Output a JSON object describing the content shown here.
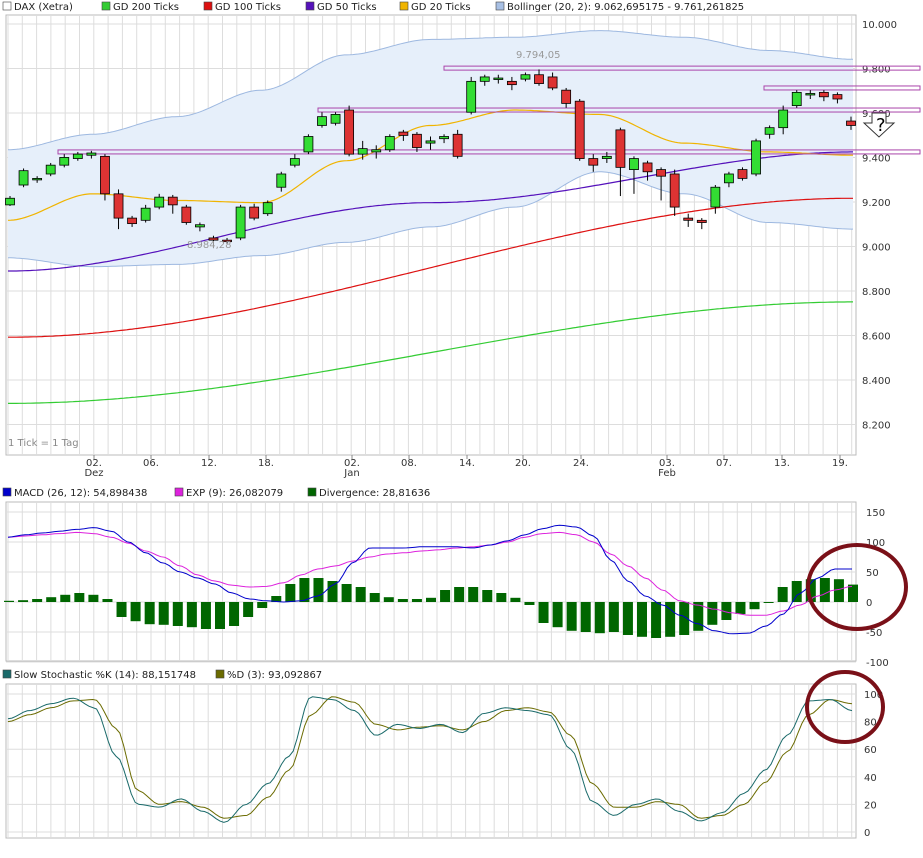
{
  "legends": {
    "price": [
      {
        "label": "DAX (Xetra)",
        "color": "#ffffff"
      },
      {
        "label": "GD 200 Ticks",
        "color": "#33cc33"
      },
      {
        "label": "GD 100 Ticks",
        "color": "#dd1111"
      },
      {
        "label": "GD 50 Ticks",
        "color": "#5511bb"
      },
      {
        "label": "GD 20 Ticks",
        "color": "#f0b400"
      },
      {
        "label": "Bollinger (20, 2): 9.062,695175 - 9.761,261825",
        "color": "#a8c0e4"
      }
    ],
    "macd": [
      {
        "label": "MACD (26, 12): 54,898438",
        "color": "#0000cc"
      },
      {
        "label": "EXP (9): 26,082079",
        "color": "#dd22dd"
      },
      {
        "label": "Divergence: 28,81636",
        "color": "#006600"
      }
    ],
    "stoch": [
      {
        "label": "Slow Stochastic %K (14): 88,151748",
        "color": "#1a6a6a"
      },
      {
        "label": "%D (3): 93,092867",
        "color": "#6b6b00"
      }
    ]
  },
  "annotations": {
    "tick_note": "1 Tick = 1 Tag",
    "high_label": "9.794,05",
    "low_label": "8.984,28",
    "question": "?"
  },
  "colors": {
    "up_candle": "#33dd33",
    "down_candle": "#dd3333",
    "grid": "#dddddd",
    "circle": "#7a1018",
    "resistance": "#aa44aa"
  },
  "chart_data": [
    {
      "type": "candlestick",
      "title": "DAX (Xetra)",
      "x_ticks": [
        {
          "label": "02.",
          "sub": "Dez"
        },
        {
          "label": "06.",
          "sub": ""
        },
        {
          "label": "12.",
          "sub": ""
        },
        {
          "label": "18.",
          "sub": ""
        },
        {
          "label": "02.",
          "sub": "Jan"
        },
        {
          "label": "08.",
          "sub": ""
        },
        {
          "label": "14.",
          "sub": ""
        },
        {
          "label": "20.",
          "sub": ""
        },
        {
          "label": "24.",
          "sub": ""
        },
        {
          "label": "03.",
          "sub": "Feb"
        },
        {
          "label": "07.",
          "sub": ""
        },
        {
          "label": "13.",
          "sub": ""
        },
        {
          "label": "19.",
          "sub": ""
        }
      ],
      "y_ticks": [
        "10.000",
        "9.800",
        "9.600",
        "9.400",
        "9.200",
        "9.000",
        "8.800",
        "8.600",
        "8.400",
        "8.200"
      ],
      "ylim": [
        8100,
        10050
      ],
      "candles": [
        [
          9180,
          9220,
          9175,
          9210
        ],
        [
          9270,
          9345,
          9260,
          9335
        ],
        [
          9300,
          9310,
          9280,
          9300
        ],
        [
          9320,
          9370,
          9310,
          9360
        ],
        [
          9360,
          9410,
          9350,
          9395
        ],
        [
          9390,
          9420,
          9380,
          9410
        ],
        [
          9405,
          9425,
          9390,
          9415
        ],
        [
          9400,
          9410,
          9200,
          9230
        ],
        [
          9230,
          9250,
          9070,
          9120
        ],
        [
          9120,
          9130,
          9080,
          9095
        ],
        [
          9110,
          9180,
          9100,
          9165
        ],
        [
          9170,
          9230,
          9160,
          9215
        ],
        [
          9215,
          9225,
          9140,
          9180
        ],
        [
          9170,
          9180,
          9090,
          9100
        ],
        [
          9080,
          9100,
          9060,
          9090
        ],
        [
          9030,
          9040,
          8984,
          9020
        ],
        [
          9020,
          9030,
          9005,
          9015
        ],
        [
          9030,
          9180,
          9020,
          9170
        ],
        [
          9170,
          9185,
          9110,
          9120
        ],
        [
          9140,
          9200,
          9130,
          9190
        ],
        [
          9260,
          9330,
          9240,
          9320
        ],
        [
          9360,
          9410,
          9350,
          9390
        ],
        [
          9420,
          9500,
          9410,
          9490
        ],
        [
          9540,
          9600,
          9530,
          9580
        ],
        [
          9550,
          9600,
          9540,
          9590
        ],
        [
          9610,
          9630,
          9400,
          9410
        ],
        [
          9410,
          9470,
          9385,
          9435
        ],
        [
          9420,
          9450,
          9390,
          9430
        ],
        [
          9430,
          9500,
          9420,
          9490
        ],
        [
          9510,
          9520,
          9470,
          9495
        ],
        [
          9500,
          9510,
          9420,
          9440
        ],
        [
          9460,
          9490,
          9430,
          9470
        ],
        [
          9480,
          9500,
          9460,
          9490
        ],
        [
          9500,
          9520,
          9390,
          9400
        ],
        [
          9600,
          9760,
          9590,
          9740
        ],
        [
          9740,
          9770,
          9720,
          9760
        ],
        [
          9750,
          9770,
          9730,
          9755
        ],
        [
          9740,
          9760,
          9700,
          9725
        ],
        [
          9750,
          9780,
          9740,
          9770
        ],
        [
          9770,
          9794,
          9720,
          9730
        ],
        [
          9760,
          9780,
          9700,
          9710
        ],
        [
          9700,
          9710,
          9620,
          9640
        ],
        [
          9650,
          9660,
          9380,
          9390
        ],
        [
          9390,
          9410,
          9330,
          9360
        ],
        [
          9390,
          9420,
          9370,
          9400
        ],
        [
          9520,
          9530,
          9220,
          9350
        ],
        [
          9340,
          9400,
          9230,
          9390
        ],
        [
          9370,
          9380,
          9290,
          9330
        ],
        [
          9340,
          9350,
          9200,
          9310
        ],
        [
          9320,
          9340,
          9130,
          9170
        ],
        [
          9120,
          9140,
          9080,
          9110
        ],
        [
          9110,
          9120,
          9070,
          9100
        ],
        [
          9170,
          9270,
          9140,
          9260
        ],
        [
          9280,
          9330,
          9260,
          9320
        ],
        [
          9340,
          9350,
          9290,
          9300
        ],
        [
          9320,
          9480,
          9310,
          9470
        ],
        [
          9500,
          9540,
          9480,
          9530
        ],
        [
          9530,
          9630,
          9500,
          9610
        ],
        [
          9630,
          9700,
          9620,
          9690
        ],
        [
          9680,
          9700,
          9660,
          9685
        ],
        [
          9690,
          9700,
          9650,
          9670
        ],
        [
          9680,
          9690,
          9640,
          9660
        ],
        [
          9560,
          9580,
          9520,
          9540
        ]
      ],
      "series": [
        {
          "name": "GD 200 Ticks",
          "values": [
            8280,
            8740
          ]
        },
        {
          "name": "GD 100 Ticks",
          "values": [
            8580,
            9210
          ]
        },
        {
          "name": "GD 50 Ticks",
          "values": [
            8880,
            9190,
            9420
          ]
        },
        {
          "name": "GD 20 Ticks",
          "values": [
            9110,
            9230,
            9200,
            9190,
            9380,
            9540,
            9610,
            9590,
            9460,
            9420,
            9405
          ]
        },
        {
          "name": "Bollinger upper",
          "values": [
            9430,
            9500,
            9580,
            9700,
            9860,
            9930,
            9940,
            9970,
            9940,
            9880,
            9840
          ]
        },
        {
          "name": "Bollinger lower",
          "values": [
            8940,
            8900,
            8910,
            8950,
            9010,
            9080,
            9170,
            9330,
            9230,
            9100,
            9070
          ]
        }
      ],
      "resistance_levels": [
        9420,
        9610,
        9800,
        9710
      ]
    },
    {
      "type": "bar",
      "title": "MACD (26, 12)",
      "ylim": [
        -100,
        150
      ],
      "y_ticks": [
        "150",
        "100",
        "50",
        "0",
        "-50",
        "-100"
      ],
      "series": [
        {
          "name": "MACD (26, 12)",
          "values": [
            108,
            112,
            115,
            118,
            121,
            124,
            118,
            100,
            82,
            65,
            50,
            40,
            30,
            15,
            5,
            2,
            0,
            2,
            10,
            30,
            65,
            90,
            90,
            90,
            92,
            92,
            92,
            90,
            95,
            102,
            112,
            122,
            128,
            125,
            110,
            70,
            35,
            10,
            -5,
            -22,
            -36,
            -48,
            -53,
            -52,
            -40,
            -20,
            15,
            40,
            55,
            55
          ]
        },
        {
          "name": "EXP (9)",
          "values": [
            108,
            110,
            112,
            114,
            116,
            114,
            108,
            98,
            85,
            75,
            60,
            45,
            35,
            28,
            25,
            26,
            32,
            45,
            55,
            60,
            68,
            75,
            80,
            82,
            85,
            87,
            90,
            92,
            95,
            100,
            108,
            114,
            116,
            112,
            100,
            80,
            60,
            40,
            20,
            2,
            -5,
            -12,
            -18,
            -22,
            -22,
            -15,
            -5,
            10,
            20,
            26
          ]
        },
        {
          "name": "Divergence",
          "values": [
            2,
            3,
            5,
            8,
            12,
            15,
            12,
            5,
            -25,
            -32,
            -37,
            -38,
            -40,
            -42,
            -45,
            -45,
            -40,
            -25,
            -10,
            10,
            30,
            40,
            40,
            35,
            30,
            25,
            15,
            8,
            5,
            5,
            7,
            20,
            25,
            25,
            20,
            15,
            7,
            -5,
            -35,
            -42,
            -48,
            -50,
            -52,
            -50,
            -55,
            -58,
            -60,
            -58,
            -55,
            -48,
            -38,
            -30,
            -20,
            -12,
            0,
            25,
            35,
            38,
            40,
            38,
            29
          ]
        }
      ]
    },
    {
      "type": "line",
      "title": "Slow Stochastic",
      "ylim": [
        0,
        105
      ],
      "y_ticks": [
        "100",
        "80",
        "60",
        "40",
        "20",
        "0"
      ],
      "series": [
        {
          "name": "Slow Stochastic %K (14)",
          "values": [
            82,
            88,
            93,
            97,
            90,
            55,
            20,
            18,
            24,
            15,
            7,
            20,
            35,
            55,
            98,
            96,
            88,
            70,
            78,
            75,
            78,
            72,
            86,
            90,
            88,
            85,
            60,
            22,
            12,
            20,
            24,
            15,
            8,
            14,
            28,
            45,
            70,
            95,
            96,
            88
          ]
        },
        {
          "name": "%D (3)",
          "values": [
            80,
            85,
            90,
            95,
            96,
            75,
            30,
            20,
            22,
            18,
            10,
            12,
            25,
            45,
            85,
            98,
            94,
            78,
            74,
            76,
            77,
            74,
            80,
            88,
            90,
            87,
            70,
            35,
            18,
            18,
            22,
            20,
            10,
            12,
            20,
            36,
            58,
            85,
            96,
            93
          ]
        }
      ]
    }
  ]
}
